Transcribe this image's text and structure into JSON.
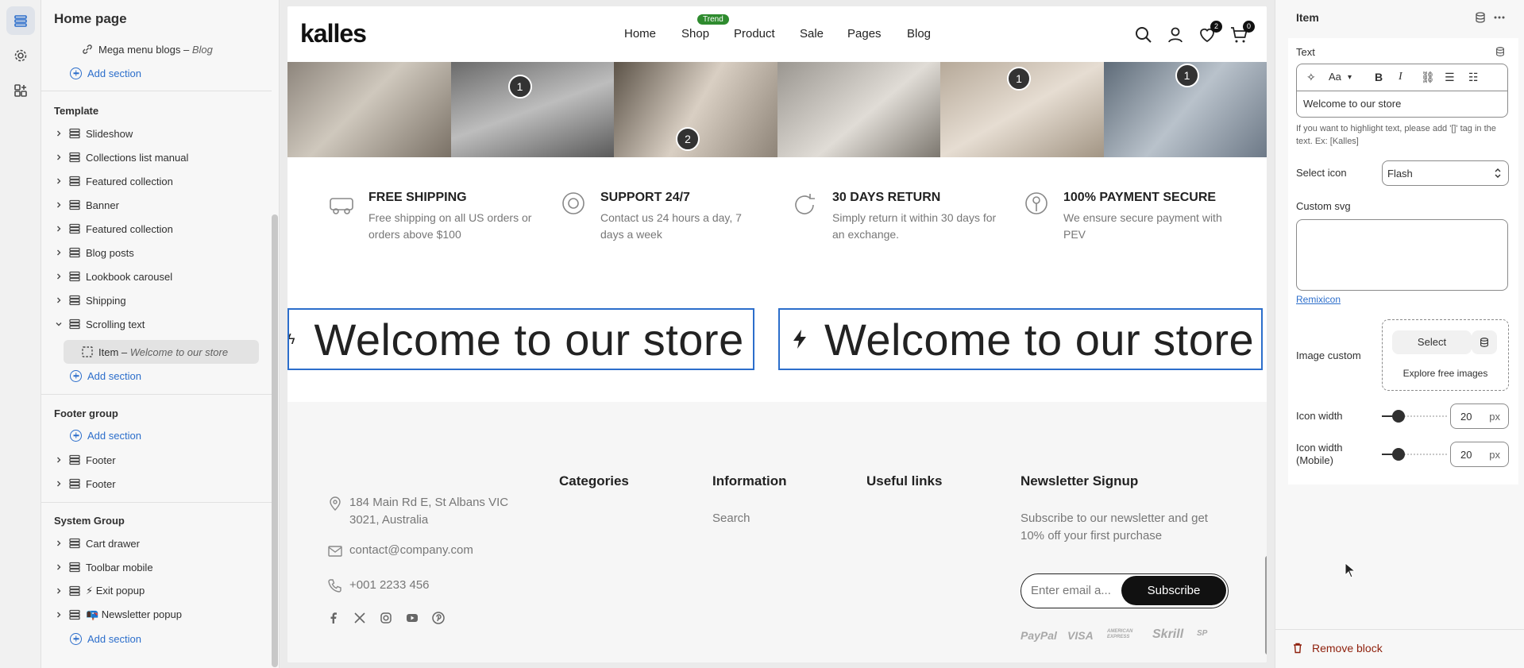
{
  "sidebar": {
    "title": "Home page",
    "top_item": {
      "label": "Mega menu blogs",
      "suffix": "Blog"
    },
    "add_section": "Add section",
    "template_group": "Template",
    "template_items": [
      "Slideshow",
      "Collections list manual",
      "Featured collection",
      "Banner",
      "Featured collection",
      "Blog posts",
      "Lookbook carousel",
      "Shipping",
      "Scrolling text"
    ],
    "sub_item": {
      "label": "Item",
      "suffix": "Welcome to our store"
    },
    "footer_group": "Footer group",
    "footer_items": [
      "Footer",
      "Footer"
    ],
    "system_group": "System Group",
    "system_items": [
      "Cart drawer",
      "Toolbar mobile",
      "⚡ Exit popup",
      "📭 Newsletter popup"
    ]
  },
  "store": {
    "logo": "kalles",
    "nav": [
      "Home",
      "Shop",
      "Product",
      "Sale",
      "Pages",
      "Blog"
    ],
    "trend_badge": "Trend",
    "wishlist_count": "2",
    "cart_count": "0",
    "hotspots": [
      "1",
      "2",
      "1",
      "1"
    ],
    "features": [
      {
        "title": "FREE SHIPPING",
        "desc": "Free shipping on all US orders or orders above $100"
      },
      {
        "title": "SUPPORT 24/7",
        "desc": "Contact us 24 hours a day, 7 days a week"
      },
      {
        "title": "30 DAYS RETURN",
        "desc": "Simply return it within 30 days for an exchange."
      },
      {
        "title": "100% PAYMENT SECURE",
        "desc": "We ensure secure payment with PEV"
      }
    ],
    "marquee_text": "Welcome to our store",
    "footer": {
      "address": "184 Main Rd E, St Albans VIC 3021, Australia",
      "email": "contact@company.com",
      "phone": "+001 2233 456",
      "col_categories": "Categories",
      "col_information": "Information",
      "info_link": "Search",
      "col_useful": "Useful links",
      "col_newsletter": "Newsletter Signup",
      "newsletter_text": "Subscribe to our newsletter and get 10% off your first purchase",
      "email_placeholder": "Enter email a...",
      "subscribe": "Subscribe",
      "payments": [
        "PayPal",
        "VISA",
        "AMERICAN EXPRESS",
        "Skrill",
        "SP"
      ]
    }
  },
  "panel": {
    "title": "Item",
    "text_label": "Text",
    "text_value": "Welcome to our store",
    "help": "If you want to highlight text, please add '[]' tag in the text. Ex: [Kalles]",
    "select_icon_label": "Select icon",
    "select_icon_value": "Flash",
    "custom_svg_label": "Custom svg",
    "remixicon_link": "Remixicon",
    "image_custom_label": "Image custom",
    "select_button": "Select",
    "explore": "Explore free images",
    "icon_width_label": "Icon width",
    "icon_width_value": "20",
    "icon_width_mobile_label": "Icon width (Mobile)",
    "icon_width_mobile_value": "20",
    "unit": "px",
    "icon_width_fraction": 0.25,
    "remove_block": "Remove block"
  }
}
